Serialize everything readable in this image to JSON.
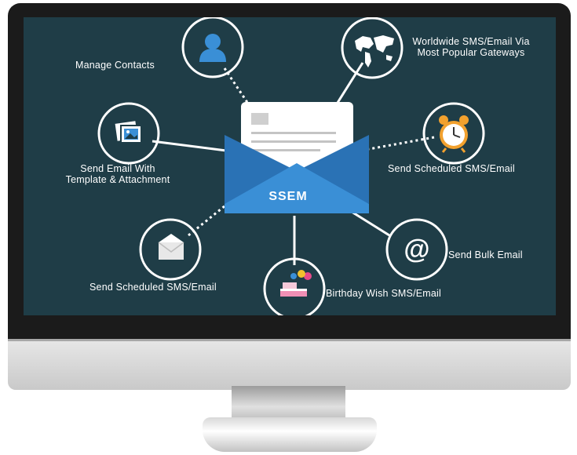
{
  "center": {
    "label": "SSEM"
  },
  "features": {
    "manage_contacts": "Manage Contacts",
    "worldwide_line1": "Worldwide SMS/Email Via",
    "worldwide_line2": "Most Popular Gateways",
    "template_line1": "Send Email With",
    "template_line2": "Template & Attachment",
    "scheduled_right": "Send Scheduled SMS/Email",
    "scheduled_left": "Send Scheduled SMS/Email",
    "bulk_email": "Send Bulk Email",
    "birthday": "Birthday Wish SMS/Email"
  },
  "icons": [
    "user-icon",
    "globe-icon",
    "picture-icon",
    "alarm-clock-icon",
    "envelope-icon",
    "at-sign-icon",
    "birthday-cake-icon"
  ],
  "colors": {
    "screen": "#1f3d47",
    "envelope_dark": "#2a72b5",
    "envelope_light": "#3a8fd6",
    "connector": "#ffffff"
  }
}
